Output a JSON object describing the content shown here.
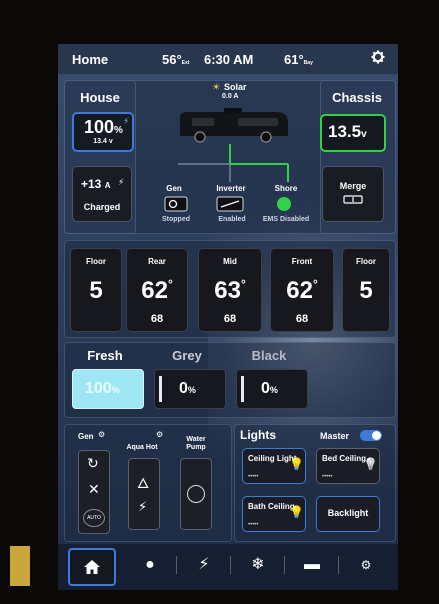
{
  "header": {
    "title": "Home",
    "outside_temp": "56°",
    "outside_label": "Ext",
    "time": "6:30 AM",
    "bay_temp": "61°",
    "bay_label": "Bay"
  },
  "house": {
    "title": "House",
    "percent": "100",
    "percent_unit": "%",
    "voltage": "13.4 v",
    "current": "+13",
    "current_unit": "A",
    "status": "Charged"
  },
  "solar": {
    "label": "Solar",
    "amps": "0.0 A"
  },
  "chassis": {
    "title": "Chassis",
    "voltage": "13.5",
    "unit": "v",
    "merge_label": "Merge"
  },
  "sources": {
    "gen_label": "Gen",
    "gen_status": "Stopped",
    "inverter_label": "Inverter",
    "inverter_status": "Enabled",
    "shore_label": "Shore",
    "shore_status": "EMS Disabled"
  },
  "climate": {
    "floor_left_label": "Floor",
    "floor_left_value": "5",
    "rear_label": "Rear",
    "rear_temp": "62",
    "rear_set": "68",
    "mid_label": "Mid",
    "mid_temp": "63",
    "mid_set": "68",
    "front_label": "Front",
    "front_temp": "62",
    "front_set": "68",
    "floor_right_label": "Floor",
    "floor_right_value": "5"
  },
  "tanks": {
    "fresh_label": "Fresh",
    "fresh_value": "100",
    "grey_label": "Grey",
    "grey_value": "0",
    "black_label": "Black",
    "black_value": "0",
    "unit": "%"
  },
  "power": {
    "gen_label": "Gen",
    "aqua_label": "Aqua Hot",
    "water_label": "Water Pump",
    "gen_auto": "AUTO"
  },
  "lights": {
    "title": "Lights",
    "master_label": "Master",
    "ceiling_light": "Ceiling Light",
    "bed_ceiling": "Bed Ceiling",
    "bath_ceiling": "Bath Ceiling",
    "backlight": "Backlight",
    "dots": "•••••"
  },
  "colors": {
    "accent_blue": "#3d7bd8",
    "chassis_green": "#33d14a",
    "fresh_fill": "#9fe6f5"
  }
}
